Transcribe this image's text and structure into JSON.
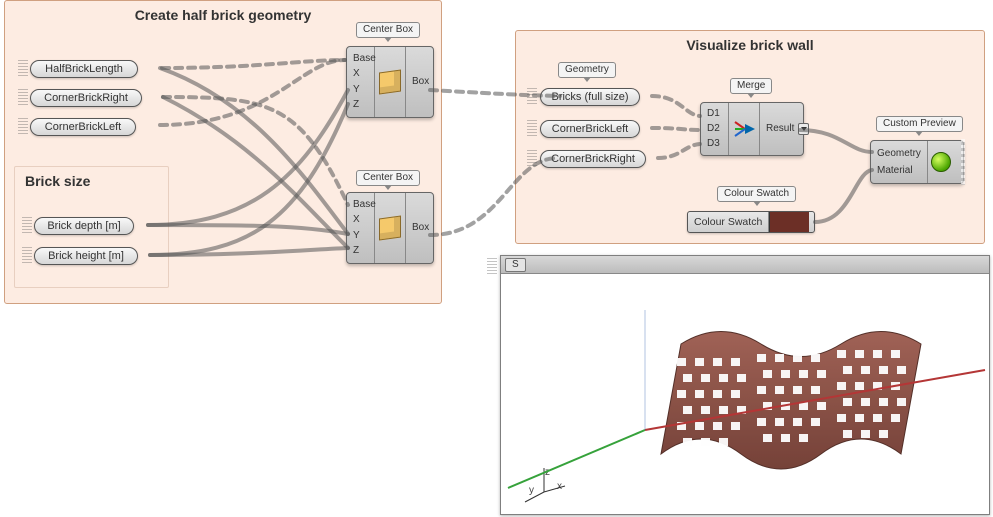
{
  "groups": {
    "left": {
      "title": "Create half brick geometry",
      "brick_size_title": "Brick size",
      "pills": {
        "half_brick_length": "HalfBrickLength",
        "corner_brick_right": "CornerBrickRight",
        "corner_brick_left": "CornerBrickLeft",
        "brick_depth": "Brick depth [m]",
        "brick_height": "Brick height [m]"
      },
      "center_box_label": "Center Box",
      "box_node": {
        "inputs": [
          "Base",
          "X",
          "Y",
          "Z"
        ],
        "output": "Box"
      }
    },
    "right": {
      "title": "Visualize brick wall",
      "geometry_label": "Geometry",
      "pills": {
        "bricks_full": "Bricks (full size)",
        "corner_brick_left": "CornerBrickLeft",
        "corner_brick_right": "CornerBrickRight"
      },
      "merge_label": "Merge",
      "merge_node": {
        "inputs": [
          "D1",
          "D2",
          "D3"
        ],
        "output": "Result"
      },
      "swatch_label": "Colour Swatch",
      "swatch_text": "Colour Swatch",
      "swatch_color": "#6c2f26",
      "custom_preview_label": "Custom Preview",
      "custom_preview_inputs": [
        "Geometry",
        "Material"
      ]
    }
  },
  "viewport": {
    "tab": "S",
    "axes": {
      "x": "x",
      "y": "y",
      "z": "z"
    }
  }
}
